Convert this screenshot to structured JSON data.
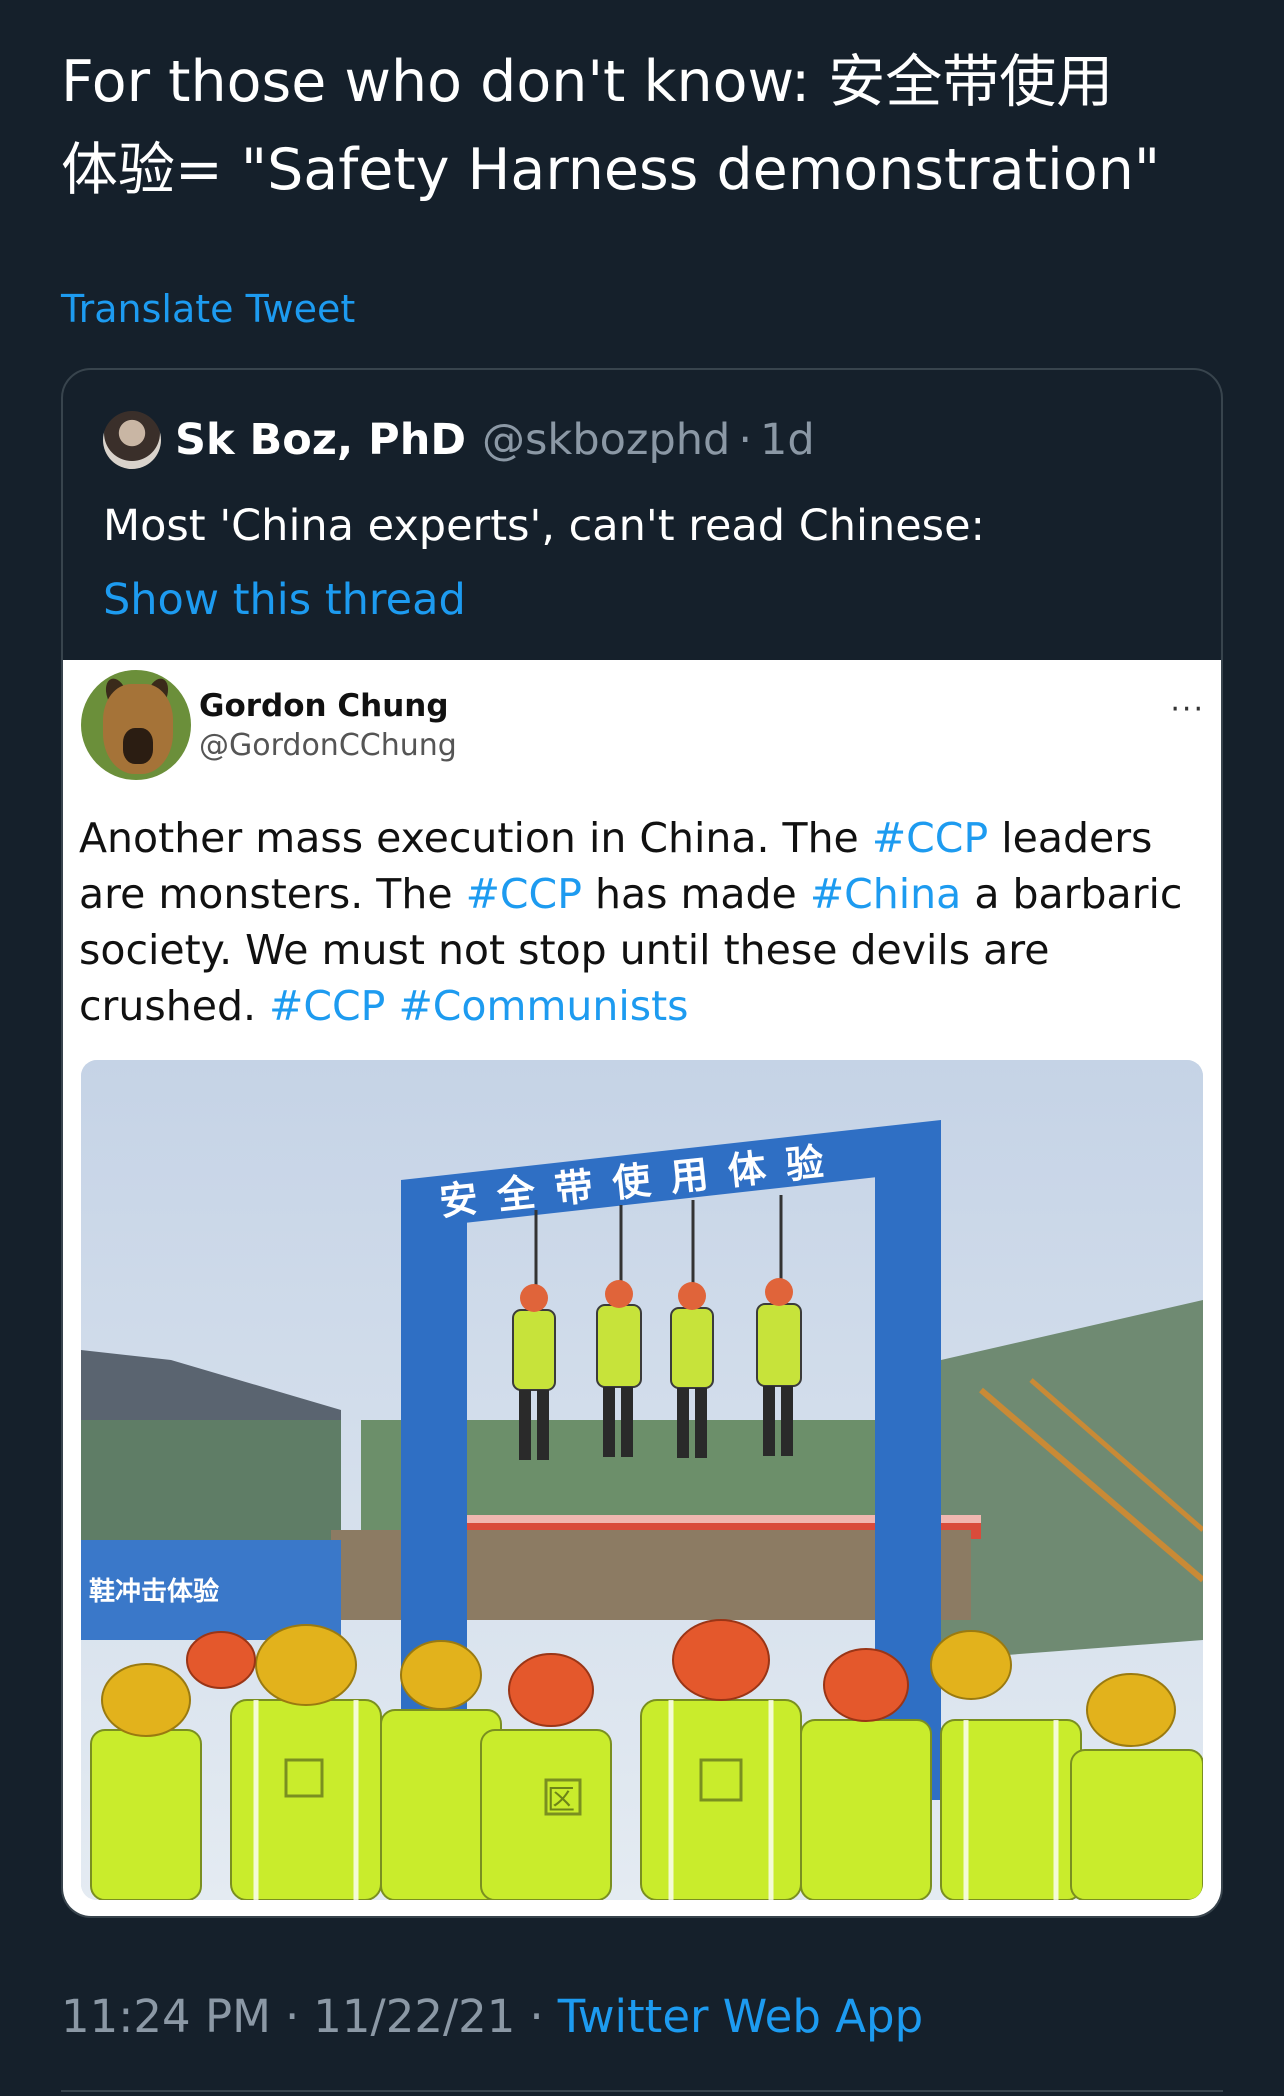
{
  "tweet": {
    "text_line1": "For those who don't know: 安全带使用",
    "text_line2": "体验= \"Safety Harness demonstration\"",
    "translate_label": "Translate Tweet",
    "time": "11:24 PM",
    "date": "11/22/21",
    "source": "Twitter Web App",
    "separator": "·"
  },
  "quote": {
    "name": "Sk Boz, PhD",
    "handle": "@skbozphd",
    "separator": "·",
    "age": "1d",
    "text": "Most 'China experts', can't read Chinese:",
    "show_thread": "Show this thread"
  },
  "embedded": {
    "name": "Gordon Chung",
    "handle": "@GordonCChung",
    "more": "···",
    "text_parts": [
      "Another mass execution in China.  The ",
      "#CCP",
      " leaders are monsters. The ",
      "#CCP",
      " has made ",
      "#China",
      " a barbaric society. We must not stop until these devils are crushed. ",
      "#CCP",
      " ",
      "#Communists"
    ],
    "photo": {
      "gate_sign": "安全带使用体验",
      "side_sign": "鞋冲击体验",
      "vest_mark": "区"
    }
  },
  "colors": {
    "background": "#15202b",
    "link": "#1d9bf0",
    "muted": "#8b98a5",
    "border": "#38444d"
  }
}
